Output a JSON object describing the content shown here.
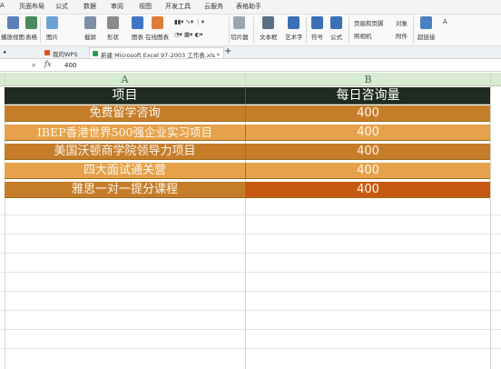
{
  "menu": {
    "tabs": [
      "A",
      "页面布局",
      "公式",
      "数据",
      "审阅",
      "视图",
      "开发工具",
      "云服务",
      "表格助手"
    ]
  },
  "ribbon": {
    "items": [
      {
        "label": "播放视图",
        "icon": "freeze-panes-icon",
        "color": "#5b7fb8"
      },
      {
        "label": "表格",
        "icon": "table-icon",
        "color": "#4a8a5b"
      },
      {
        "label": "图片",
        "icon": "picture-icon",
        "color": "#6aa2d8"
      },
      {
        "label": "截屏",
        "icon": "screenshot-icon",
        "color": "#7e8fa6"
      },
      {
        "label": "形状",
        "icon": "shapes-icon",
        "color": "#8a8a8a"
      },
      {
        "label": "图表",
        "icon": "chart-icon",
        "color": "#3e76c4"
      },
      {
        "label": "在线图表",
        "icon": "online-chart-icon",
        "color": "#e07b39"
      },
      {
        "label": "切片器",
        "icon": "slicer-icon",
        "color": "#9aa6b2"
      },
      {
        "label": "文本框",
        "icon": "textbox-icon",
        "color": "#5a6e86"
      },
      {
        "label": "艺术字",
        "icon": "wordart-icon",
        "color": "#3b6fb6"
      },
      {
        "label": "符号",
        "icon": "symbol-icon",
        "color": "#3b6fb6"
      },
      {
        "label": "公式",
        "icon": "formula-icon",
        "color": "#3b6fb6"
      },
      {
        "label": "附件",
        "icon": "attachment-icon",
        "color": "#6b8bb5"
      },
      {
        "label": "超链接",
        "icon": "hyperlink-icon",
        "color": "#4a7fc1"
      }
    ],
    "small": {
      "header_footer": "页眉和页脚",
      "object": "对象",
      "camera": "照相机",
      "abc": "A"
    }
  },
  "doc_tabs": {
    "tab1": "我的WPS",
    "tab2": "新建 Microsoft Excel 97-2003 工作表.xls *",
    "add": "+"
  },
  "formula_bar": {
    "fx": "fx",
    "value": "400"
  },
  "sheet": {
    "col_a": "A",
    "col_b": "B",
    "header": {
      "item": "项目",
      "count": "每日咨询量"
    },
    "rows": [
      {
        "item": "免费留学咨询",
        "count": "400"
      },
      {
        "item": "IBEP香港世界500强企业实习项目",
        "count": "400"
      },
      {
        "item": "美国沃顿商学院领导力项目",
        "count": "400"
      },
      {
        "item": "四大面试通关营",
        "count": "400"
      },
      {
        "item": "雅思一对一提分课程",
        "count": "400"
      }
    ]
  },
  "colors": {
    "header_fill": "#1f2a20",
    "row_fill_a": "#c67d2a",
    "row_fill_b": "#e6a24a",
    "active_cell": "#c65911",
    "column_header": "#d9ead3"
  }
}
